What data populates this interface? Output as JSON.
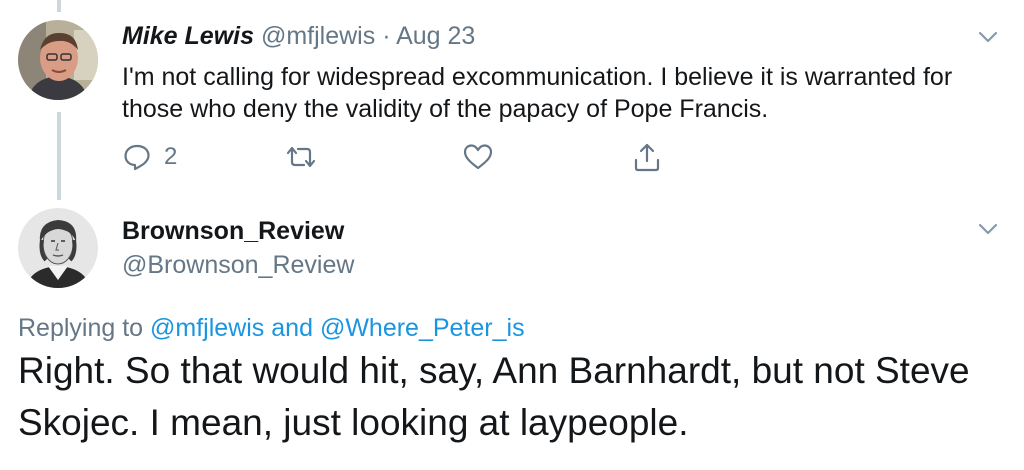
{
  "tweet1": {
    "author_name": "Mike Lewis",
    "handle": "@mfjlewis",
    "separator": "·",
    "date": "Aug 23",
    "text": "I'm not calling for widespread excommunication. I believe it is warranted for those who deny the validity of the papacy of Pope Francis.",
    "actions": {
      "reply_icon": "reply-icon",
      "reply_count": "2",
      "retweet_icon": "retweet-icon",
      "like_icon": "heart-icon",
      "share_icon": "share-icon"
    },
    "menu_icon": "chevron-down-icon"
  },
  "tweet2": {
    "author_name": "Brownson_Review",
    "handle": "@Brownson_Review",
    "replying_prefix": "Replying to",
    "replying_to": [
      "@mfjlewis",
      "@Where_Peter_is"
    ],
    "replying_joiner": "and",
    "text": "Right. So that would hit, say, Ann Barnhardt, but not Steve Skojec. I mean, just looking at laypeople.",
    "menu_icon": "chevron-down-icon"
  },
  "colors": {
    "text_primary": "#14171a",
    "text_secondary": "#657786",
    "link": "#1b95e0",
    "thread_line": "#ccd6dd"
  }
}
